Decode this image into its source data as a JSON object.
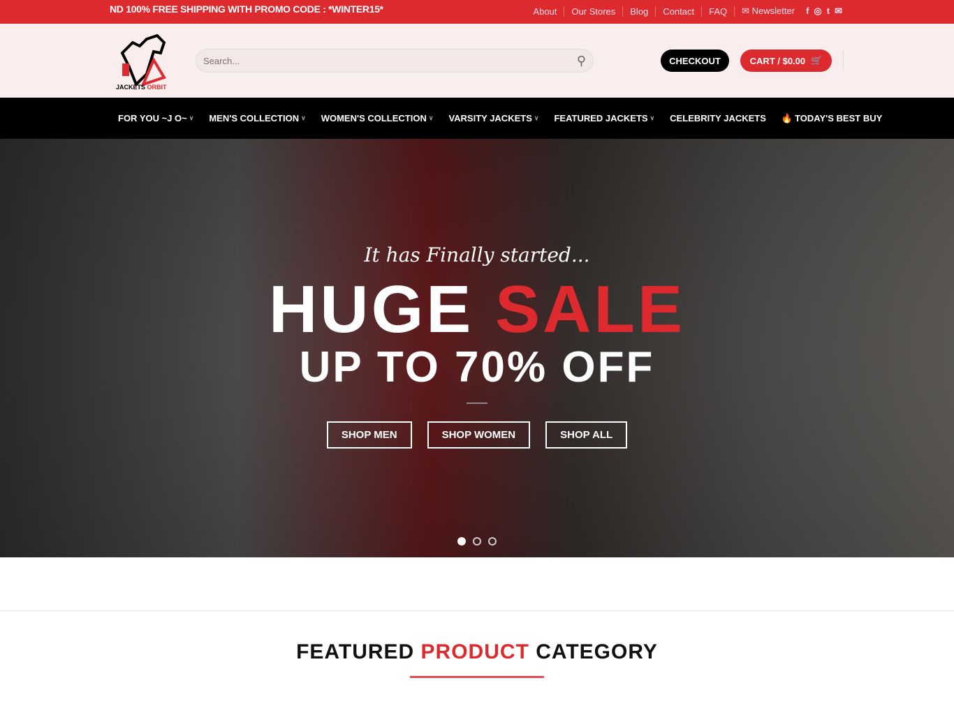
{
  "topbar": {
    "promo": "ND 100% FREE SHIPPING WITH PROMO CODE : *WINTER15*",
    "links": [
      "About",
      "Our Stores",
      "Blog",
      "Contact",
      "FAQ"
    ],
    "newsletter": "Newsletter",
    "social": [
      "facebook-icon",
      "instagram-icon",
      "twitter-icon",
      "email-icon"
    ]
  },
  "header": {
    "logo_text_1": "JACKETS",
    "logo_text_2": "ORBIT",
    "search_placeholder": "Search...",
    "checkout": "CHECKOUT",
    "cart": "CART / $0.00"
  },
  "nav": [
    {
      "label": "FOR YOU ~J O~",
      "dropdown": true
    },
    {
      "label": "MEN'S COLLECTION",
      "dropdown": true
    },
    {
      "label": "WOMEN'S COLLECTION",
      "dropdown": true
    },
    {
      "label": "VARSITY JACKETS",
      "dropdown": true
    },
    {
      "label": "FEATURED JACKETS",
      "dropdown": true
    },
    {
      "label": "CELEBRITY JACKETS",
      "dropdown": false
    },
    {
      "label": "TODAY'S BEST BUY",
      "dropdown": false,
      "icon": "fire-icon"
    }
  ],
  "hero": {
    "tagline": "It has Finally started...",
    "huge": "HUGE",
    "sale": "SALE",
    "upto": "UP TO 70% OFF",
    "buttons": [
      "SHOP MEN",
      "SHOP WOMEN",
      "SHOP ALL"
    ],
    "slides": 3,
    "active_slide": 1
  },
  "section": {
    "title_1": "FEATURED",
    "title_2": "PRODUCT",
    "title_3": "CATEGORY"
  },
  "colors": {
    "accent": "#dd2a2f",
    "nav_bg": "#000000",
    "header_bg": "#f9eded"
  }
}
